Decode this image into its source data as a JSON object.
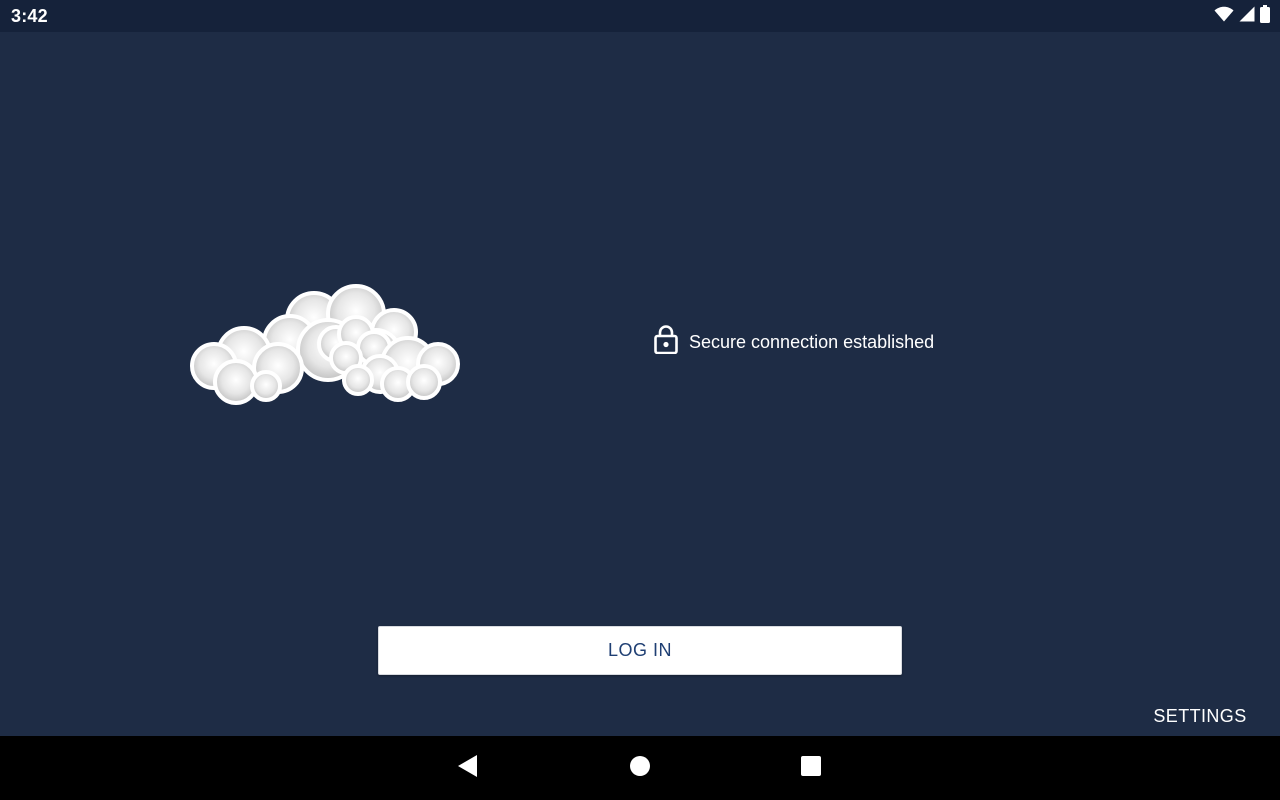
{
  "status_bar": {
    "time": "3:42",
    "icons": [
      "wifi-icon",
      "cell-signal-icon",
      "battery-icon"
    ]
  },
  "main": {
    "logo": "cloud-logo",
    "secure_status": {
      "icon": "lock-icon",
      "text": "Secure connection established"
    },
    "login_label": "LOG IN",
    "settings_label": "SETTINGS"
  },
  "nav_bar": {
    "buttons": [
      "back-icon",
      "home-icon",
      "recents-icon"
    ]
  },
  "colors": {
    "background": "#1e2c45",
    "status_bar": "#15223a",
    "button_text": "#1f3f73",
    "nav_bar": "#000000"
  }
}
